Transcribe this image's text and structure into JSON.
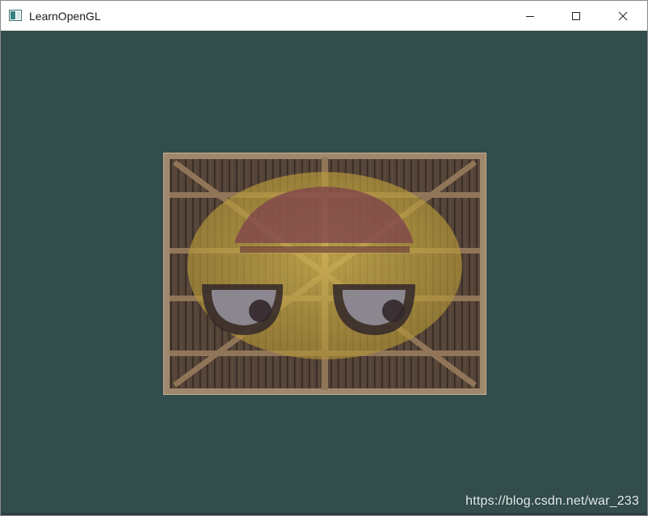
{
  "window": {
    "title": "LearnOpenGL",
    "controls": {
      "minimize_icon": "minimize-icon",
      "maximize_icon": "maximize-icon",
      "close_icon": "close-icon"
    }
  },
  "viewport": {
    "clear_color": "#334d4d",
    "texture_primary": "wooden-container",
    "texture_secondary": "awesome-face",
    "mix_note": "blended"
  },
  "watermark": {
    "text": "https://blog.csdn.net/war_233"
  },
  "colors": {
    "titlebar_bg": "#ffffff",
    "clear_color": "#334d4d",
    "wood_dark": "#4a3a2e",
    "wood_frame": "#b49a7a",
    "face_yellow": "#c9a83a"
  }
}
